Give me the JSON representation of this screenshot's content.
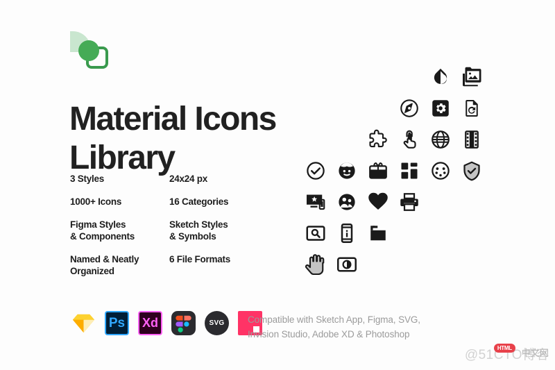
{
  "brand": {
    "logo_name": "material-icons-library-logo",
    "leaf_color": "#c9e6cf",
    "dot_color": "#45ab56",
    "square_color": "#3a9a4e"
  },
  "title": {
    "line1": "Material Icons",
    "line2": "Library",
    "color": "#212121"
  },
  "features": [
    {
      "left": "3 Styles",
      "right": "24x24 px"
    },
    {
      "left": "1000+ Icons",
      "right": "16 Categories"
    },
    {
      "left": "Figma Styles\n& Components",
      "right": "Sketch Styles\n& Symbols"
    },
    {
      "left": "Named & Neatly\nOrganized",
      "right": "6 File Formats"
    }
  ],
  "feature_rows": [
    {
      "left_l1": "3 Styles",
      "left_l2": "",
      "right_l1": "24x24 px",
      "right_l2": ""
    },
    {
      "left_l1": "1000+ Icons",
      "left_l2": "",
      "right_l1": "16 Categories",
      "right_l2": ""
    },
    {
      "left_l1": "Figma Styles",
      "left_l2": "& Components",
      "right_l1": "Sketch Styles",
      "right_l2": "& Symbols"
    },
    {
      "left_l1": "Named & Neatly",
      "left_l2": "Organized",
      "right_l1": "6 File Formats",
      "right_l2": ""
    }
  ],
  "app_icons": [
    {
      "name": "sketch-app-icon",
      "label": ""
    },
    {
      "name": "photoshop-app-icon",
      "label": "Ps"
    },
    {
      "name": "adobe-xd-app-icon",
      "label": "Xd"
    },
    {
      "name": "figma-app-icon",
      "label": ""
    },
    {
      "name": "svg-format-icon",
      "label": "SVG"
    },
    {
      "name": "invision-studio-app-icon",
      "label": ""
    }
  ],
  "compatibility": {
    "line1": "Compatible with Sketch App, Figma, SVG,",
    "line2": "Invision Studio, Adobe XD & Photoshop",
    "color": "#9b9b9b"
  },
  "icon_grid": {
    "rows": [
      {
        "offset": 4,
        "icons": [
          "opacity-drop-icon",
          "photo-library-icon"
        ]
      },
      {
        "offset": 3,
        "icons": [
          "explore-compass-icon",
          "settings-applications-icon",
          "file-restore-icon"
        ]
      },
      {
        "offset": 2,
        "icons": [
          "extension-puzzle-icon",
          "touch-app-icon",
          "public-globe-icon",
          "theaters-film-icon"
        ]
      },
      {
        "offset": 0,
        "icons": [
          "check-circle-icon",
          "face-icon",
          "card-giftcard-icon",
          "dashboard-icon",
          "settings-input-svideo-icon",
          "verified-shield-icon"
        ]
      },
      {
        "offset": 0,
        "icons": [
          "important-devices-icon",
          "group-people-icon",
          "favorite-heart-icon",
          "print-icon"
        ]
      },
      {
        "offset": 0,
        "icons": [
          "screen-search-desktop-icon",
          "perm-device-information-icon",
          "folder-flag-icon"
        ]
      },
      {
        "offset": 0,
        "icons": [
          "pan-tool-hand-icon",
          "brightness-contrast-icon"
        ]
      }
    ],
    "stroke_color": "#1a1a1a",
    "fill_gray": "#c4c4c4"
  },
  "watermark": {
    "text": "@51CTO博客",
    "badge": "HTML",
    "badge_suffix": "中文网"
  }
}
